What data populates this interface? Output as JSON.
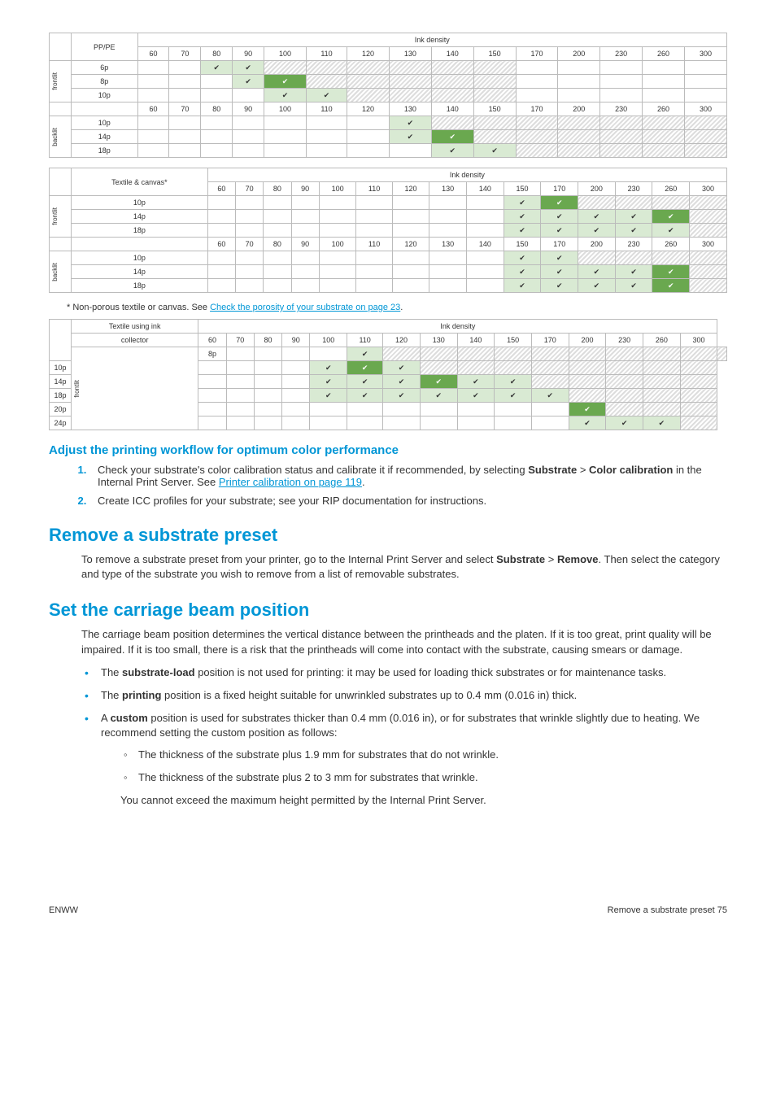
{
  "table1": {
    "rowheader_label": "PP/PE",
    "topheader": "Ink density",
    "cols": [
      "60",
      "70",
      "80",
      "90",
      "100",
      "110",
      "120",
      "130",
      "140",
      "150",
      "170",
      "200",
      "230",
      "260",
      "300"
    ],
    "groups": [
      {
        "label": "frontlit",
        "rows": [
          {
            "name": "6p",
            "cells": [
              "",
              "",
              "lt",
              "lt",
              "h",
              "h",
              "h",
              "h",
              "h",
              "h",
              "",
              "",
              "",
              "",
              ""
            ]
          },
          {
            "name": "8p",
            "cells": [
              "",
              "",
              "",
              "lt",
              "g",
              "h",
              "h",
              "h",
              "h",
              "h",
              "",
              "",
              "",
              "",
              ""
            ]
          },
          {
            "name": "10p",
            "cells": [
              "",
              "",
              "",
              "",
              "lt",
              "lt",
              "h",
              "h",
              "h",
              "h",
              "",
              "",
              "",
              "",
              ""
            ]
          }
        ]
      },
      {
        "repeat_header": true
      },
      {
        "label": "backlit",
        "rows": [
          {
            "name": "10p",
            "cells": [
              "",
              "",
              "",
              "",
              "",
              "",
              "",
              "lt",
              "h",
              "h",
              "h",
              "h",
              "h",
              "h",
              "h"
            ]
          },
          {
            "name": "14p",
            "cells": [
              "",
              "",
              "",
              "",
              "",
              "",
              "",
              "lt",
              "g",
              "h",
              "h",
              "h",
              "h",
              "h",
              "h"
            ]
          },
          {
            "name": "18p",
            "cells": [
              "",
              "",
              "",
              "",
              "",
              "",
              "",
              "",
              "lt",
              "lt",
              "h",
              "h",
              "h",
              "h",
              "h"
            ]
          }
        ]
      }
    ]
  },
  "table2": {
    "rowheader_label": "Textile & canvas*",
    "topheader": "Ink density",
    "cols": [
      "60",
      "70",
      "80",
      "90",
      "100",
      "110",
      "120",
      "130",
      "140",
      "150",
      "170",
      "200",
      "230",
      "260",
      "300"
    ],
    "groups": [
      {
        "label": "frontlit",
        "rows": [
          {
            "name": "10p",
            "cells": [
              "",
              "",
              "",
              "",
              "",
              "",
              "",
              "",
              "",
              "lt",
              "g",
              "h",
              "h",
              "h",
              "h"
            ]
          },
          {
            "name": "14p",
            "cells": [
              "",
              "",
              "",
              "",
              "",
              "",
              "",
              "",
              "",
              "lt",
              "lt",
              "lt",
              "lt",
              "g",
              "h"
            ]
          },
          {
            "name": "18p",
            "cells": [
              "",
              "",
              "",
              "",
              "",
              "",
              "",
              "",
              "",
              "lt",
              "lt",
              "lt",
              "lt",
              "lt",
              "h"
            ]
          }
        ]
      },
      {
        "repeat_header": true
      },
      {
        "label": "backlit",
        "rows": [
          {
            "name": "10p",
            "cells": [
              "",
              "",
              "",
              "",
              "",
              "",
              "",
              "",
              "",
              "lt",
              "lt",
              "h",
              "h",
              "h",
              "h"
            ]
          },
          {
            "name": "14p",
            "cells": [
              "",
              "",
              "",
              "",
              "",
              "",
              "",
              "",
              "",
              "lt",
              "lt",
              "lt",
              "lt",
              "g",
              "h"
            ]
          },
          {
            "name": "18p",
            "cells": [
              "",
              "",
              "",
              "",
              "",
              "",
              "",
              "",
              "",
              "lt",
              "lt",
              "lt",
              "lt",
              "g",
              "h"
            ]
          }
        ]
      }
    ]
  },
  "note_text_a": "* Non-porous textile or canvas. See ",
  "note_link": "Check the porosity of your substrate on page 23",
  "note_text_b": ".",
  "table3": {
    "rowheader_label_a": "Textile using ink",
    "rowheader_label_b": "collector",
    "topheader": "Ink density",
    "cols": [
      "60",
      "70",
      "80",
      "90",
      "100",
      "110",
      "120",
      "130",
      "140",
      "150",
      "170",
      "200",
      "230",
      "260",
      "300"
    ],
    "groups": [
      {
        "label": "frontlit",
        "rows": [
          {
            "name": "8p",
            "cells": [
              "",
              "",
              "",
              "",
              "lt",
              "h",
              "h",
              "h",
              "h",
              "h",
              "h",
              "h",
              "h",
              "h",
              "h"
            ]
          },
          {
            "name": "10p",
            "cells": [
              "",
              "",
              "",
              "",
              "lt",
              "g",
              "lt",
              "h",
              "h",
              "h",
              "h",
              "h",
              "h",
              "h",
              "h"
            ]
          },
          {
            "name": "14p",
            "cells": [
              "",
              "",
              "",
              "",
              "lt",
              "lt",
              "lt",
              "g",
              "lt",
              "lt",
              "h",
              "h",
              "h",
              "h",
              "h"
            ]
          },
          {
            "name": "18p",
            "cells": [
              "",
              "",
              "",
              "",
              "lt",
              "lt",
              "lt",
              "lt",
              "lt",
              "lt",
              "lt",
              "h",
              "h",
              "h",
              "h"
            ]
          },
          {
            "name": "20p",
            "cells": [
              "",
              "",
              "",
              "",
              "",
              "",
              "",
              "",
              "",
              "",
              "",
              "g",
              "h",
              "h",
              "h"
            ]
          },
          {
            "name": "24p",
            "cells": [
              "",
              "",
              "",
              "",
              "",
              "",
              "",
              "",
              "",
              "",
              "",
              "lt",
              "lt",
              "lt",
              "h"
            ]
          }
        ]
      }
    ]
  },
  "h_adjust": "Adjust the printing workflow for optimum color performance",
  "step1a": "Check your substrate's color calibration status and calibrate it if recommended, by selecting ",
  "step1_bold1": "Substrate",
  "step1b": " > ",
  "step1_bold2": "Color calibration",
  "step1c": " in the Internal Print Server. See ",
  "step1_link": "Printer calibration on page 119",
  "step1d": ".",
  "step2": "Create ICC profiles for your substrate; see your RIP documentation for instructions.",
  "h_remove": "Remove a substrate preset",
  "remove_p_a": "To remove a substrate preset from your printer, go to the Internal Print Server and select ",
  "remove_b1": "Substrate",
  "remove_p_b": " > ",
  "remove_b2": "Remove",
  "remove_p_c": ". Then select the category and type of the substrate you wish to remove from a list of removable substrates.",
  "h_set": "Set the carriage beam position",
  "set_p": "The carriage beam position determines the vertical distance between the printheads and the platen. If it is too great, print quality will be impaired. If it is too small, there is a risk that the printheads will come into contact with the substrate, causing smears or damage.",
  "bul1a": "The ",
  "bul1b": "substrate-load",
  "bul1c": " position is not used for printing: it may be used for loading thick substrates or for maintenance tasks.",
  "bul2a": "The ",
  "bul2b": "printing",
  "bul2c": " position is a fixed height suitable for unwrinkled substrates up to 0.4 mm (0.016 in) thick.",
  "bul3a": "A ",
  "bul3b": "custom",
  "bul3c": " position is used for substrates thicker than 0.4 mm (0.016 in), or for substrates that wrinkle slightly due to heating. We recommend setting the custom position as follows:",
  "sub1": "The thickness of the substrate plus 1.9 mm for substrates that do not wrinkle.",
  "sub2": "The thickness of the substrate plus 2 to 3 mm for substrates that wrinkle.",
  "sub_note": "You cannot exceed the maximum height permitted by the Internal Print Server.",
  "footer_left": "ENWW",
  "footer_right": "Remove a substrate preset     75",
  "chart_data": [
    {
      "type": "table",
      "title": "PP/PE Ink density compatibility",
      "xlabel": "Ink density",
      "columns": [
        60,
        70,
        80,
        90,
        100,
        110,
        120,
        130,
        140,
        150,
        170,
        200,
        230,
        260,
        300
      ],
      "legend": {
        "": "blank",
        "lt": "check (light)",
        "g": "check (recommended)",
        "h": "not applicable / hatched"
      },
      "groups": {
        "frontlit": {
          "6p": [
            "",
            "",
            "lt",
            "lt",
            "h",
            "h",
            "h",
            "h",
            "h",
            "h",
            "",
            "",
            "",
            "",
            ""
          ],
          "8p": [
            "",
            "",
            "",
            "lt",
            "g",
            "h",
            "h",
            "h",
            "h",
            "h",
            "",
            "",
            "",
            "",
            ""
          ],
          "10p": [
            "",
            "",
            "",
            "",
            "lt",
            "lt",
            "h",
            "h",
            "h",
            "h",
            "",
            "",
            "",
            "",
            ""
          ]
        },
        "backlit": {
          "10p": [
            "",
            "",
            "",
            "",
            "",
            "",
            "",
            "lt",
            "h",
            "h",
            "h",
            "h",
            "h",
            "h",
            "h"
          ],
          "14p": [
            "",
            "",
            "",
            "",
            "",
            "",
            "",
            "lt",
            "g",
            "h",
            "h",
            "h",
            "h",
            "h",
            "h"
          ],
          "18p": [
            "",
            "",
            "",
            "",
            "",
            "",
            "",
            "",
            "lt",
            "lt",
            "h",
            "h",
            "h",
            "h",
            "h"
          ]
        }
      }
    },
    {
      "type": "table",
      "title": "Textile & canvas Ink density compatibility",
      "xlabel": "Ink density",
      "columns": [
        60,
        70,
        80,
        90,
        100,
        110,
        120,
        130,
        140,
        150,
        170,
        200,
        230,
        260,
        300
      ],
      "groups": {
        "frontlit": {
          "10p": [
            "",
            "",
            "",
            "",
            "",
            "",
            "",
            "",
            "",
            "lt",
            "g",
            "h",
            "h",
            "h",
            "h"
          ],
          "14p": [
            "",
            "",
            "",
            "",
            "",
            "",
            "",
            "",
            "",
            "lt",
            "lt",
            "lt",
            "lt",
            "g",
            "h"
          ],
          "18p": [
            "",
            "",
            "",
            "",
            "",
            "",
            "",
            "",
            "",
            "lt",
            "lt",
            "lt",
            "lt",
            "lt",
            "h"
          ]
        },
        "backlit": {
          "10p": [
            "",
            "",
            "",
            "",
            "",
            "",
            "",
            "",
            "",
            "lt",
            "lt",
            "h",
            "h",
            "h",
            "h"
          ],
          "14p": [
            "",
            "",
            "",
            "",
            "",
            "",
            "",
            "",
            "",
            "lt",
            "lt",
            "lt",
            "lt",
            "g",
            "h"
          ],
          "18p": [
            "",
            "",
            "",
            "",
            "",
            "",
            "",
            "",
            "",
            "lt",
            "lt",
            "lt",
            "lt",
            "g",
            "h"
          ]
        }
      }
    },
    {
      "type": "table",
      "title": "Textile using ink collector Ink density compatibility",
      "xlabel": "Ink density",
      "columns": [
        60,
        70,
        80,
        90,
        100,
        110,
        120,
        130,
        140,
        150,
        170,
        200,
        230,
        260,
        300
      ],
      "groups": {
        "frontlit": {
          "8p": [
            "",
            "",
            "",
            "",
            "lt",
            "h",
            "h",
            "h",
            "h",
            "h",
            "h",
            "h",
            "h",
            "h",
            "h"
          ],
          "10p": [
            "",
            "",
            "",
            "",
            "lt",
            "g",
            "lt",
            "h",
            "h",
            "h",
            "h",
            "h",
            "h",
            "h",
            "h"
          ],
          "14p": [
            "",
            "",
            "",
            "",
            "lt",
            "lt",
            "lt",
            "g",
            "lt",
            "lt",
            "h",
            "h",
            "h",
            "h",
            "h"
          ],
          "18p": [
            "",
            "",
            "",
            "",
            "lt",
            "lt",
            "lt",
            "lt",
            "lt",
            "lt",
            "lt",
            "h",
            "h",
            "h",
            "h"
          ],
          "20p": [
            "",
            "",
            "",
            "",
            "",
            "",
            "",
            "",
            "",
            "",
            "",
            "g",
            "h",
            "h",
            "h"
          ],
          "24p": [
            "",
            "",
            "",
            "",
            "",
            "",
            "",
            "",
            "",
            "",
            "",
            "lt",
            "lt",
            "lt",
            "h"
          ]
        }
      }
    }
  ]
}
